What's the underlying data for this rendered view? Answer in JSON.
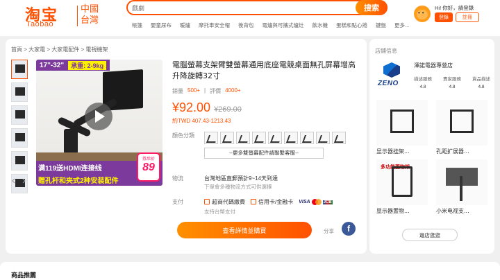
{
  "header": {
    "logo_cn": "淘宝",
    "logo_en": "Taobao",
    "logo_region": "中國台灣",
    "search_placeholder": "戲劇",
    "search_button": "搜索",
    "hotwords": [
      "帳篷",
      "嬰童尿布",
      "暖爐",
      "摩托車安全帽",
      "後背包",
      "電爐與可攜式爐灶",
      "飲水機",
      "蛋糕和點心捲",
      "鍵盤",
      "更多..."
    ],
    "greeting": "Hi! 你好，請登錄",
    "login": "登錄",
    "register": "註冊"
  },
  "product": {
    "breadcrumb": "首頁 > 大家電 > 大家電配件 > 電視機架",
    "image": {
      "tag_size": "17\"-32\"",
      "tag_load": "承重: 2-9kg",
      "promo_line1": "满119送HDMI连接线",
      "promo_line2": "赠孔杆和夹式2种安装配件",
      "badge_label": "券后价",
      "badge_price": "89"
    },
    "title": "電腦螢幕支架臂雙螢幕通用底座電競桌面無孔屏幕增高升降旋轉32寸",
    "sales_label": "銷量",
    "sales_value": "500+",
    "reviews_label": "評價",
    "reviews_value": "4000+",
    "price_now": "¥92.00",
    "price_old": "¥269.00",
    "price_twd": "約TWD 407.43-1213.43",
    "color_label": "顏色分類",
    "more_options": "--更多雙螢幕配件請聯繫客服--",
    "shipping_label": "物流",
    "shipping_main": "台灣地區直郵預計9~14天到達",
    "shipping_sub": "下單會多種物流方式可供選擇",
    "payment_label": "支付",
    "pay_store": "超商代碼繳費",
    "pay_card": "信用卡/金融卡",
    "pay_visa": "VISA",
    "pay_jcb": "JCB",
    "pay_sub": "支持台幣支付",
    "buy_button": "查看詳情並購買",
    "share_label": "分享",
    "fb_icon": "f"
  },
  "store": {
    "title": "店鋪信息",
    "logo_text": "ZENO",
    "name": "澤諾電器專營店",
    "ratings": [
      {
        "label": "描述服務",
        "value": "4.8"
      },
      {
        "label": "賣家服務",
        "value": "4.8"
      },
      {
        "label": "貨品描述",
        "value": "4.8"
      }
    ],
    "recommend": [
      {
        "name": "显示器挂架..."
      },
      {
        "name": "孔距扩展器..."
      },
      {
        "name": "显示器置物...",
        "badge": "多功能置物架"
      },
      {
        "name": "小米电视支..."
      }
    ],
    "enter_button": "進店逛逛"
  },
  "recommend_section": {
    "title": "商品推薦"
  }
}
